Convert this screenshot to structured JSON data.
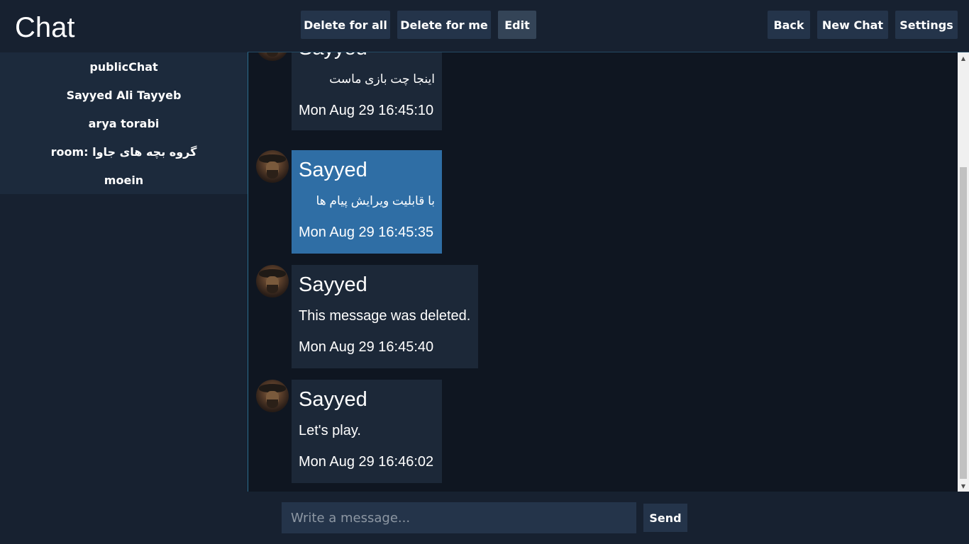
{
  "header": {
    "title": "Chat",
    "buttons": {
      "delete_for_all": "Delete for all",
      "delete_for_me": "Delete for me",
      "edit": "Edit",
      "back": "Back",
      "new_chat": "New Chat",
      "settings": "Settings"
    }
  },
  "sidebar": {
    "chats": [
      {
        "label": "publicChat"
      },
      {
        "label": "Sayyed Ali Tayyeb"
      },
      {
        "label": "arya torabi"
      },
      {
        "label": "room: گروه بچه های جاوا"
      },
      {
        "label": "moein"
      }
    ]
  },
  "messages": [
    {
      "sender": "Sayyed",
      "text": "اینجا چت بازی ماست",
      "separator": "____________________",
      "time": "Mon Aug 29 16:45:10",
      "selected": false
    },
    {
      "sender": "Sayyed",
      "text": "با قابلیت ویرایش پیام ها",
      "separator": "____________________",
      "time": "Mon Aug 29 16:45:35",
      "selected": true
    },
    {
      "sender": "Sayyed",
      "text": "This message was deleted.",
      "separator": "____________________",
      "time": "Mon Aug 29 16:45:40",
      "selected": false
    },
    {
      "sender": "Sayyed",
      "text": "Let's play.",
      "separator": "____________________",
      "time": "Mon Aug 29 16:46:02",
      "selected": false
    }
  ],
  "composer": {
    "placeholder": "Write a message...",
    "send_label": "Send"
  },
  "colors": {
    "background": "#172130",
    "panel": "#1c2a3c",
    "message_area": "#0f1621",
    "button": "#24344a",
    "selected_message": "#2f6ea5"
  }
}
